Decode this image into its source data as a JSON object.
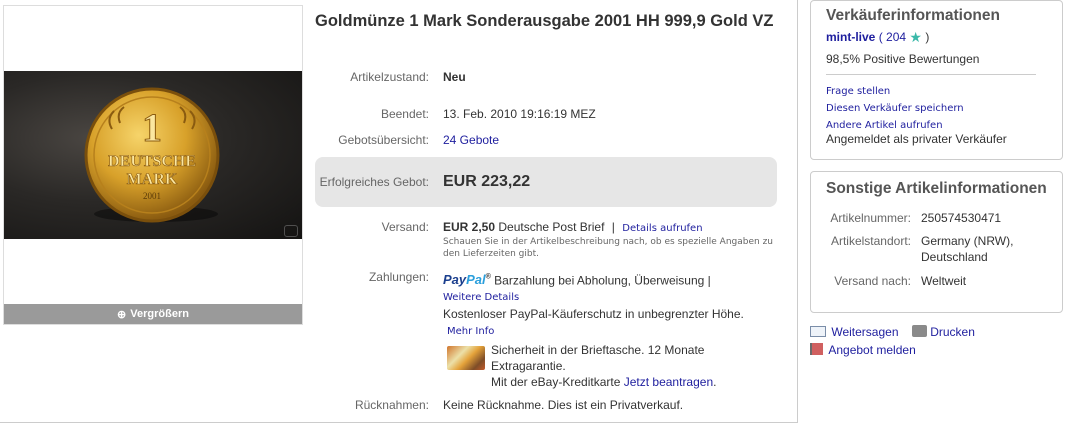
{
  "listing": {
    "title": "Goldmünze 1 Mark Sonderausgabe 2001 HH 999,9 Gold VZ",
    "image": {
      "coin_top": "1",
      "coin_line1": "DEUTSCHE",
      "coin_line2": "MARK",
      "coin_year": "2001",
      "enlarge_label": "Vergrößern"
    },
    "condition": {
      "label": "Artikelzustand:",
      "value": "Neu"
    },
    "ended": {
      "label": "Beendet:",
      "value": "13. Feb. 2010 19:16:19 MEZ"
    },
    "bids": {
      "label": "Gebotsübersicht:",
      "value": "24 Gebote"
    },
    "winning_bid": {
      "label": "Erfolgreiches Gebot:",
      "value": "EUR 223,22"
    },
    "shipping": {
      "label": "Versand:",
      "cost": "EUR 2,50",
      "method": "Deutsche Post Brief",
      "separator": "|",
      "details_link": "Details aufrufen",
      "note": "Schauen Sie in der Artikelbeschreibung nach, ob es spezielle Angaben zu den Lieferzeiten gibt."
    },
    "payment": {
      "label": "Zahlungen:",
      "paypal_pay": "Pay",
      "paypal_pal": "Pal",
      "paypal_reg": "®",
      "methods": "Barzahlung bei Abholung, Überweisung |",
      "more_details": "Weitere Details",
      "buyer_protection": "Kostenloser PayPal-Käuferschutz in unbegrenzter Höhe.",
      "more_info": "Mehr Info",
      "card_line1": "Sicherheit in der Brieftasche. 12 Monate Extragarantie.",
      "card_line2": "Mit der eBay-Kreditkarte",
      "apply_now": "Jetzt beantragen",
      "apply_suffix": "."
    },
    "returns": {
      "label": "Rücknahmen:",
      "value": "Keine Rücknahme. Dies ist ein Privatverkauf."
    }
  },
  "seller": {
    "heading": "Verkäuferinformationen",
    "username": "mint-live",
    "feedback_open": "(",
    "feedback_score": "204",
    "feedback_close": ")",
    "positive": "98,5% Positive Bewertungen",
    "links": [
      "Frage stellen",
      "Diesen Verkäufer speichern",
      "Andere Artikel aufrufen"
    ],
    "registered_as": "Angemeldet als privater Verkäufer"
  },
  "other_info": {
    "heading": "Sonstige Artikelinformationen",
    "item_number_label": "Artikelnummer:",
    "item_number": "250574530471",
    "location_label": "Artikelstandort:",
    "location": "Germany (NRW), Deutschland",
    "ships_to_label": "Versand nach:",
    "ships_to": "Weltweit"
  },
  "actions": {
    "share": "Weitersagen",
    "print": "Drucken",
    "report": "Angebot melden"
  },
  "colors": {
    "link": "#1e1e9e",
    "price_box": "#e6e6e6",
    "enlarge_bar": "#9a9a9a",
    "star": "#3bb9a9",
    "gold": "#d8a12a"
  }
}
